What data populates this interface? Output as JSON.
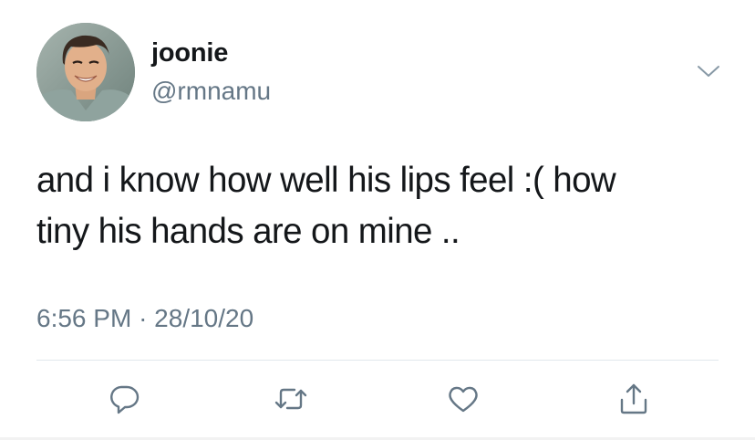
{
  "author": {
    "display_name": "joonie",
    "handle": "@rmnamu"
  },
  "tweet": {
    "text_line1": "and i know how well his lips feel :( how",
    "text_line2": "tiny his hands are on mine ..",
    "time": "6:56 PM",
    "separator": "·",
    "date": "28/10/20"
  },
  "icons": {
    "menu": "chevron-down-icon",
    "reply": "reply-icon",
    "retweet": "retweet-icon",
    "like": "heart-icon",
    "share": "share-icon"
  },
  "colors": {
    "text_primary": "#14171a",
    "text_secondary": "#657786",
    "icon": "#657786",
    "divider": "#e1e8ed"
  }
}
